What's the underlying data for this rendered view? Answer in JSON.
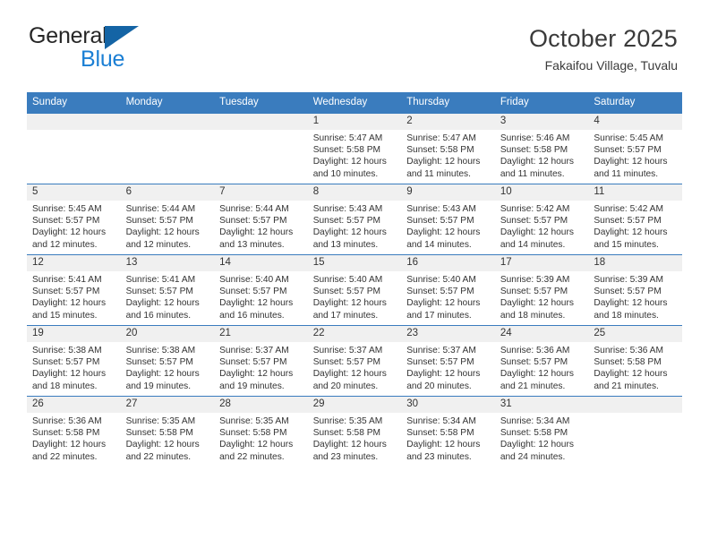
{
  "brand": {
    "name_part1": "General",
    "name_part2": "Blue",
    "logo_icon": "triangle-logo"
  },
  "header": {
    "title": "October 2025",
    "subtitle": "Fakaifou Village, Tuvalu",
    "accent_color": "#3a7cbe",
    "brand_blue": "#1b7fd4"
  },
  "calendar": {
    "weekday_headers": [
      "Sunday",
      "Monday",
      "Tuesday",
      "Wednesday",
      "Thursday",
      "Friday",
      "Saturday"
    ],
    "weeks": [
      [
        {
          "day": "",
          "sunrise": "",
          "sunset": "",
          "daylight1": "",
          "daylight2": "",
          "empty": true
        },
        {
          "day": "",
          "sunrise": "",
          "sunset": "",
          "daylight1": "",
          "daylight2": "",
          "empty": true
        },
        {
          "day": "",
          "sunrise": "",
          "sunset": "",
          "daylight1": "",
          "daylight2": "",
          "empty": true
        },
        {
          "day": "1",
          "sunrise": "Sunrise: 5:47 AM",
          "sunset": "Sunset: 5:58 PM",
          "daylight1": "Daylight: 12 hours",
          "daylight2": "and 10 minutes.",
          "empty": false
        },
        {
          "day": "2",
          "sunrise": "Sunrise: 5:47 AM",
          "sunset": "Sunset: 5:58 PM",
          "daylight1": "Daylight: 12 hours",
          "daylight2": "and 11 minutes.",
          "empty": false
        },
        {
          "day": "3",
          "sunrise": "Sunrise: 5:46 AM",
          "sunset": "Sunset: 5:58 PM",
          "daylight1": "Daylight: 12 hours",
          "daylight2": "and 11 minutes.",
          "empty": false
        },
        {
          "day": "4",
          "sunrise": "Sunrise: 5:45 AM",
          "sunset": "Sunset: 5:57 PM",
          "daylight1": "Daylight: 12 hours",
          "daylight2": "and 11 minutes.",
          "empty": false
        }
      ],
      [
        {
          "day": "5",
          "sunrise": "Sunrise: 5:45 AM",
          "sunset": "Sunset: 5:57 PM",
          "daylight1": "Daylight: 12 hours",
          "daylight2": "and 12 minutes.",
          "empty": false
        },
        {
          "day": "6",
          "sunrise": "Sunrise: 5:44 AM",
          "sunset": "Sunset: 5:57 PM",
          "daylight1": "Daylight: 12 hours",
          "daylight2": "and 12 minutes.",
          "empty": false
        },
        {
          "day": "7",
          "sunrise": "Sunrise: 5:44 AM",
          "sunset": "Sunset: 5:57 PM",
          "daylight1": "Daylight: 12 hours",
          "daylight2": "and 13 minutes.",
          "empty": false
        },
        {
          "day": "8",
          "sunrise": "Sunrise: 5:43 AM",
          "sunset": "Sunset: 5:57 PM",
          "daylight1": "Daylight: 12 hours",
          "daylight2": "and 13 minutes.",
          "empty": false
        },
        {
          "day": "9",
          "sunrise": "Sunrise: 5:43 AM",
          "sunset": "Sunset: 5:57 PM",
          "daylight1": "Daylight: 12 hours",
          "daylight2": "and 14 minutes.",
          "empty": false
        },
        {
          "day": "10",
          "sunrise": "Sunrise: 5:42 AM",
          "sunset": "Sunset: 5:57 PM",
          "daylight1": "Daylight: 12 hours",
          "daylight2": "and 14 minutes.",
          "empty": false
        },
        {
          "day": "11",
          "sunrise": "Sunrise: 5:42 AM",
          "sunset": "Sunset: 5:57 PM",
          "daylight1": "Daylight: 12 hours",
          "daylight2": "and 15 minutes.",
          "empty": false
        }
      ],
      [
        {
          "day": "12",
          "sunrise": "Sunrise: 5:41 AM",
          "sunset": "Sunset: 5:57 PM",
          "daylight1": "Daylight: 12 hours",
          "daylight2": "and 15 minutes.",
          "empty": false
        },
        {
          "day": "13",
          "sunrise": "Sunrise: 5:41 AM",
          "sunset": "Sunset: 5:57 PM",
          "daylight1": "Daylight: 12 hours",
          "daylight2": "and 16 minutes.",
          "empty": false
        },
        {
          "day": "14",
          "sunrise": "Sunrise: 5:40 AM",
          "sunset": "Sunset: 5:57 PM",
          "daylight1": "Daylight: 12 hours",
          "daylight2": "and 16 minutes.",
          "empty": false
        },
        {
          "day": "15",
          "sunrise": "Sunrise: 5:40 AM",
          "sunset": "Sunset: 5:57 PM",
          "daylight1": "Daylight: 12 hours",
          "daylight2": "and 17 minutes.",
          "empty": false
        },
        {
          "day": "16",
          "sunrise": "Sunrise: 5:40 AM",
          "sunset": "Sunset: 5:57 PM",
          "daylight1": "Daylight: 12 hours",
          "daylight2": "and 17 minutes.",
          "empty": false
        },
        {
          "day": "17",
          "sunrise": "Sunrise: 5:39 AM",
          "sunset": "Sunset: 5:57 PM",
          "daylight1": "Daylight: 12 hours",
          "daylight2": "and 18 minutes.",
          "empty": false
        },
        {
          "day": "18",
          "sunrise": "Sunrise: 5:39 AM",
          "sunset": "Sunset: 5:57 PM",
          "daylight1": "Daylight: 12 hours",
          "daylight2": "and 18 minutes.",
          "empty": false
        }
      ],
      [
        {
          "day": "19",
          "sunrise": "Sunrise: 5:38 AM",
          "sunset": "Sunset: 5:57 PM",
          "daylight1": "Daylight: 12 hours",
          "daylight2": "and 18 minutes.",
          "empty": false
        },
        {
          "day": "20",
          "sunrise": "Sunrise: 5:38 AM",
          "sunset": "Sunset: 5:57 PM",
          "daylight1": "Daylight: 12 hours",
          "daylight2": "and 19 minutes.",
          "empty": false
        },
        {
          "day": "21",
          "sunrise": "Sunrise: 5:37 AM",
          "sunset": "Sunset: 5:57 PM",
          "daylight1": "Daylight: 12 hours",
          "daylight2": "and 19 minutes.",
          "empty": false
        },
        {
          "day": "22",
          "sunrise": "Sunrise: 5:37 AM",
          "sunset": "Sunset: 5:57 PM",
          "daylight1": "Daylight: 12 hours",
          "daylight2": "and 20 minutes.",
          "empty": false
        },
        {
          "day": "23",
          "sunrise": "Sunrise: 5:37 AM",
          "sunset": "Sunset: 5:57 PM",
          "daylight1": "Daylight: 12 hours",
          "daylight2": "and 20 minutes.",
          "empty": false
        },
        {
          "day": "24",
          "sunrise": "Sunrise: 5:36 AM",
          "sunset": "Sunset: 5:57 PM",
          "daylight1": "Daylight: 12 hours",
          "daylight2": "and 21 minutes.",
          "empty": false
        },
        {
          "day": "25",
          "sunrise": "Sunrise: 5:36 AM",
          "sunset": "Sunset: 5:58 PM",
          "daylight1": "Daylight: 12 hours",
          "daylight2": "and 21 minutes.",
          "empty": false
        }
      ],
      [
        {
          "day": "26",
          "sunrise": "Sunrise: 5:36 AM",
          "sunset": "Sunset: 5:58 PM",
          "daylight1": "Daylight: 12 hours",
          "daylight2": "and 22 minutes.",
          "empty": false
        },
        {
          "day": "27",
          "sunrise": "Sunrise: 5:35 AM",
          "sunset": "Sunset: 5:58 PM",
          "daylight1": "Daylight: 12 hours",
          "daylight2": "and 22 minutes.",
          "empty": false
        },
        {
          "day": "28",
          "sunrise": "Sunrise: 5:35 AM",
          "sunset": "Sunset: 5:58 PM",
          "daylight1": "Daylight: 12 hours",
          "daylight2": "and 22 minutes.",
          "empty": false
        },
        {
          "day": "29",
          "sunrise": "Sunrise: 5:35 AM",
          "sunset": "Sunset: 5:58 PM",
          "daylight1": "Daylight: 12 hours",
          "daylight2": "and 23 minutes.",
          "empty": false
        },
        {
          "day": "30",
          "sunrise": "Sunrise: 5:34 AM",
          "sunset": "Sunset: 5:58 PM",
          "daylight1": "Daylight: 12 hours",
          "daylight2": "and 23 minutes.",
          "empty": false
        },
        {
          "day": "31",
          "sunrise": "Sunrise: 5:34 AM",
          "sunset": "Sunset: 5:58 PM",
          "daylight1": "Daylight: 12 hours",
          "daylight2": "and 24 minutes.",
          "empty": false
        },
        {
          "day": "",
          "sunrise": "",
          "sunset": "",
          "daylight1": "",
          "daylight2": "",
          "empty": true
        }
      ]
    ]
  }
}
